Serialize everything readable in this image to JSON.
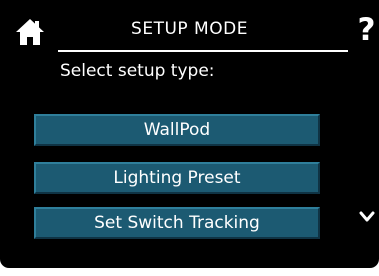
{
  "header": {
    "title": "SETUP MODE",
    "help_label": "?",
    "home_icon": "home-icon"
  },
  "prompt": "Select setup type:",
  "options": [
    {
      "label": "WallPod"
    },
    {
      "label": "Lighting Preset"
    },
    {
      "label": "Set Switch Tracking"
    }
  ],
  "scroll_icon": "chevron-down-icon",
  "colors": {
    "background": "#000000",
    "text": "#ffffff",
    "button_fill": "#1c5a72",
    "button_highlight": "#2f7f9b",
    "button_shadow": "#0f3344"
  }
}
